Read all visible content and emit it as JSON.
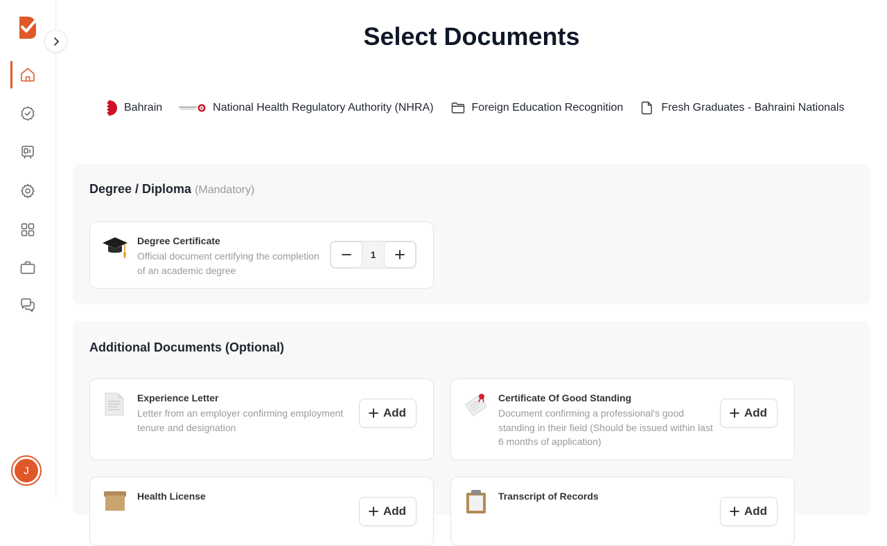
{
  "page": {
    "title": "Select Documents"
  },
  "sidebar": {
    "items": [
      {
        "name": "home",
        "active": true
      },
      {
        "name": "verified"
      },
      {
        "name": "id-card"
      },
      {
        "name": "settings"
      },
      {
        "name": "apps"
      },
      {
        "name": "briefcase"
      },
      {
        "name": "chat"
      }
    ],
    "avatar_initial": "J",
    "accent": "#e0582a"
  },
  "breadcrumbs": [
    {
      "icon": "bahrain-flag-icon",
      "label": "Bahrain"
    },
    {
      "icon": "nhra-logo-icon",
      "label": "National Health Regulatory Authority (NHRA)"
    },
    {
      "icon": "folder-icon",
      "label": "Foreign Education Recognition"
    },
    {
      "icon": "file-icon",
      "label": "Fresh Graduates - Bahraini Nationals"
    }
  ],
  "mandatory_section": {
    "title": "Degree / Diploma",
    "tag": "(Mandatory)",
    "documents": [
      {
        "icon": "graduation-cap-icon",
        "title": "Degree Certificate",
        "description": "Official document certifying the completion of an academic degree",
        "quantity": "1"
      }
    ]
  },
  "additional_section": {
    "title": "Additional Documents (Optional)",
    "add_label": "Add",
    "documents": [
      {
        "icon": "letter-icon",
        "title": "Experience Letter",
        "description": "Letter from an employer confirming employment tenure and designation"
      },
      {
        "icon": "certificate-icon",
        "title": "Certificate Of Good Standing",
        "description": "Document confirming a professional's good standing in their field (Should be issued within last 6 months of application)"
      },
      {
        "icon": "license-icon",
        "title": "Health License",
        "description": ""
      },
      {
        "icon": "clipboard-icon",
        "title": "Transcript of Records",
        "description": ""
      }
    ]
  }
}
